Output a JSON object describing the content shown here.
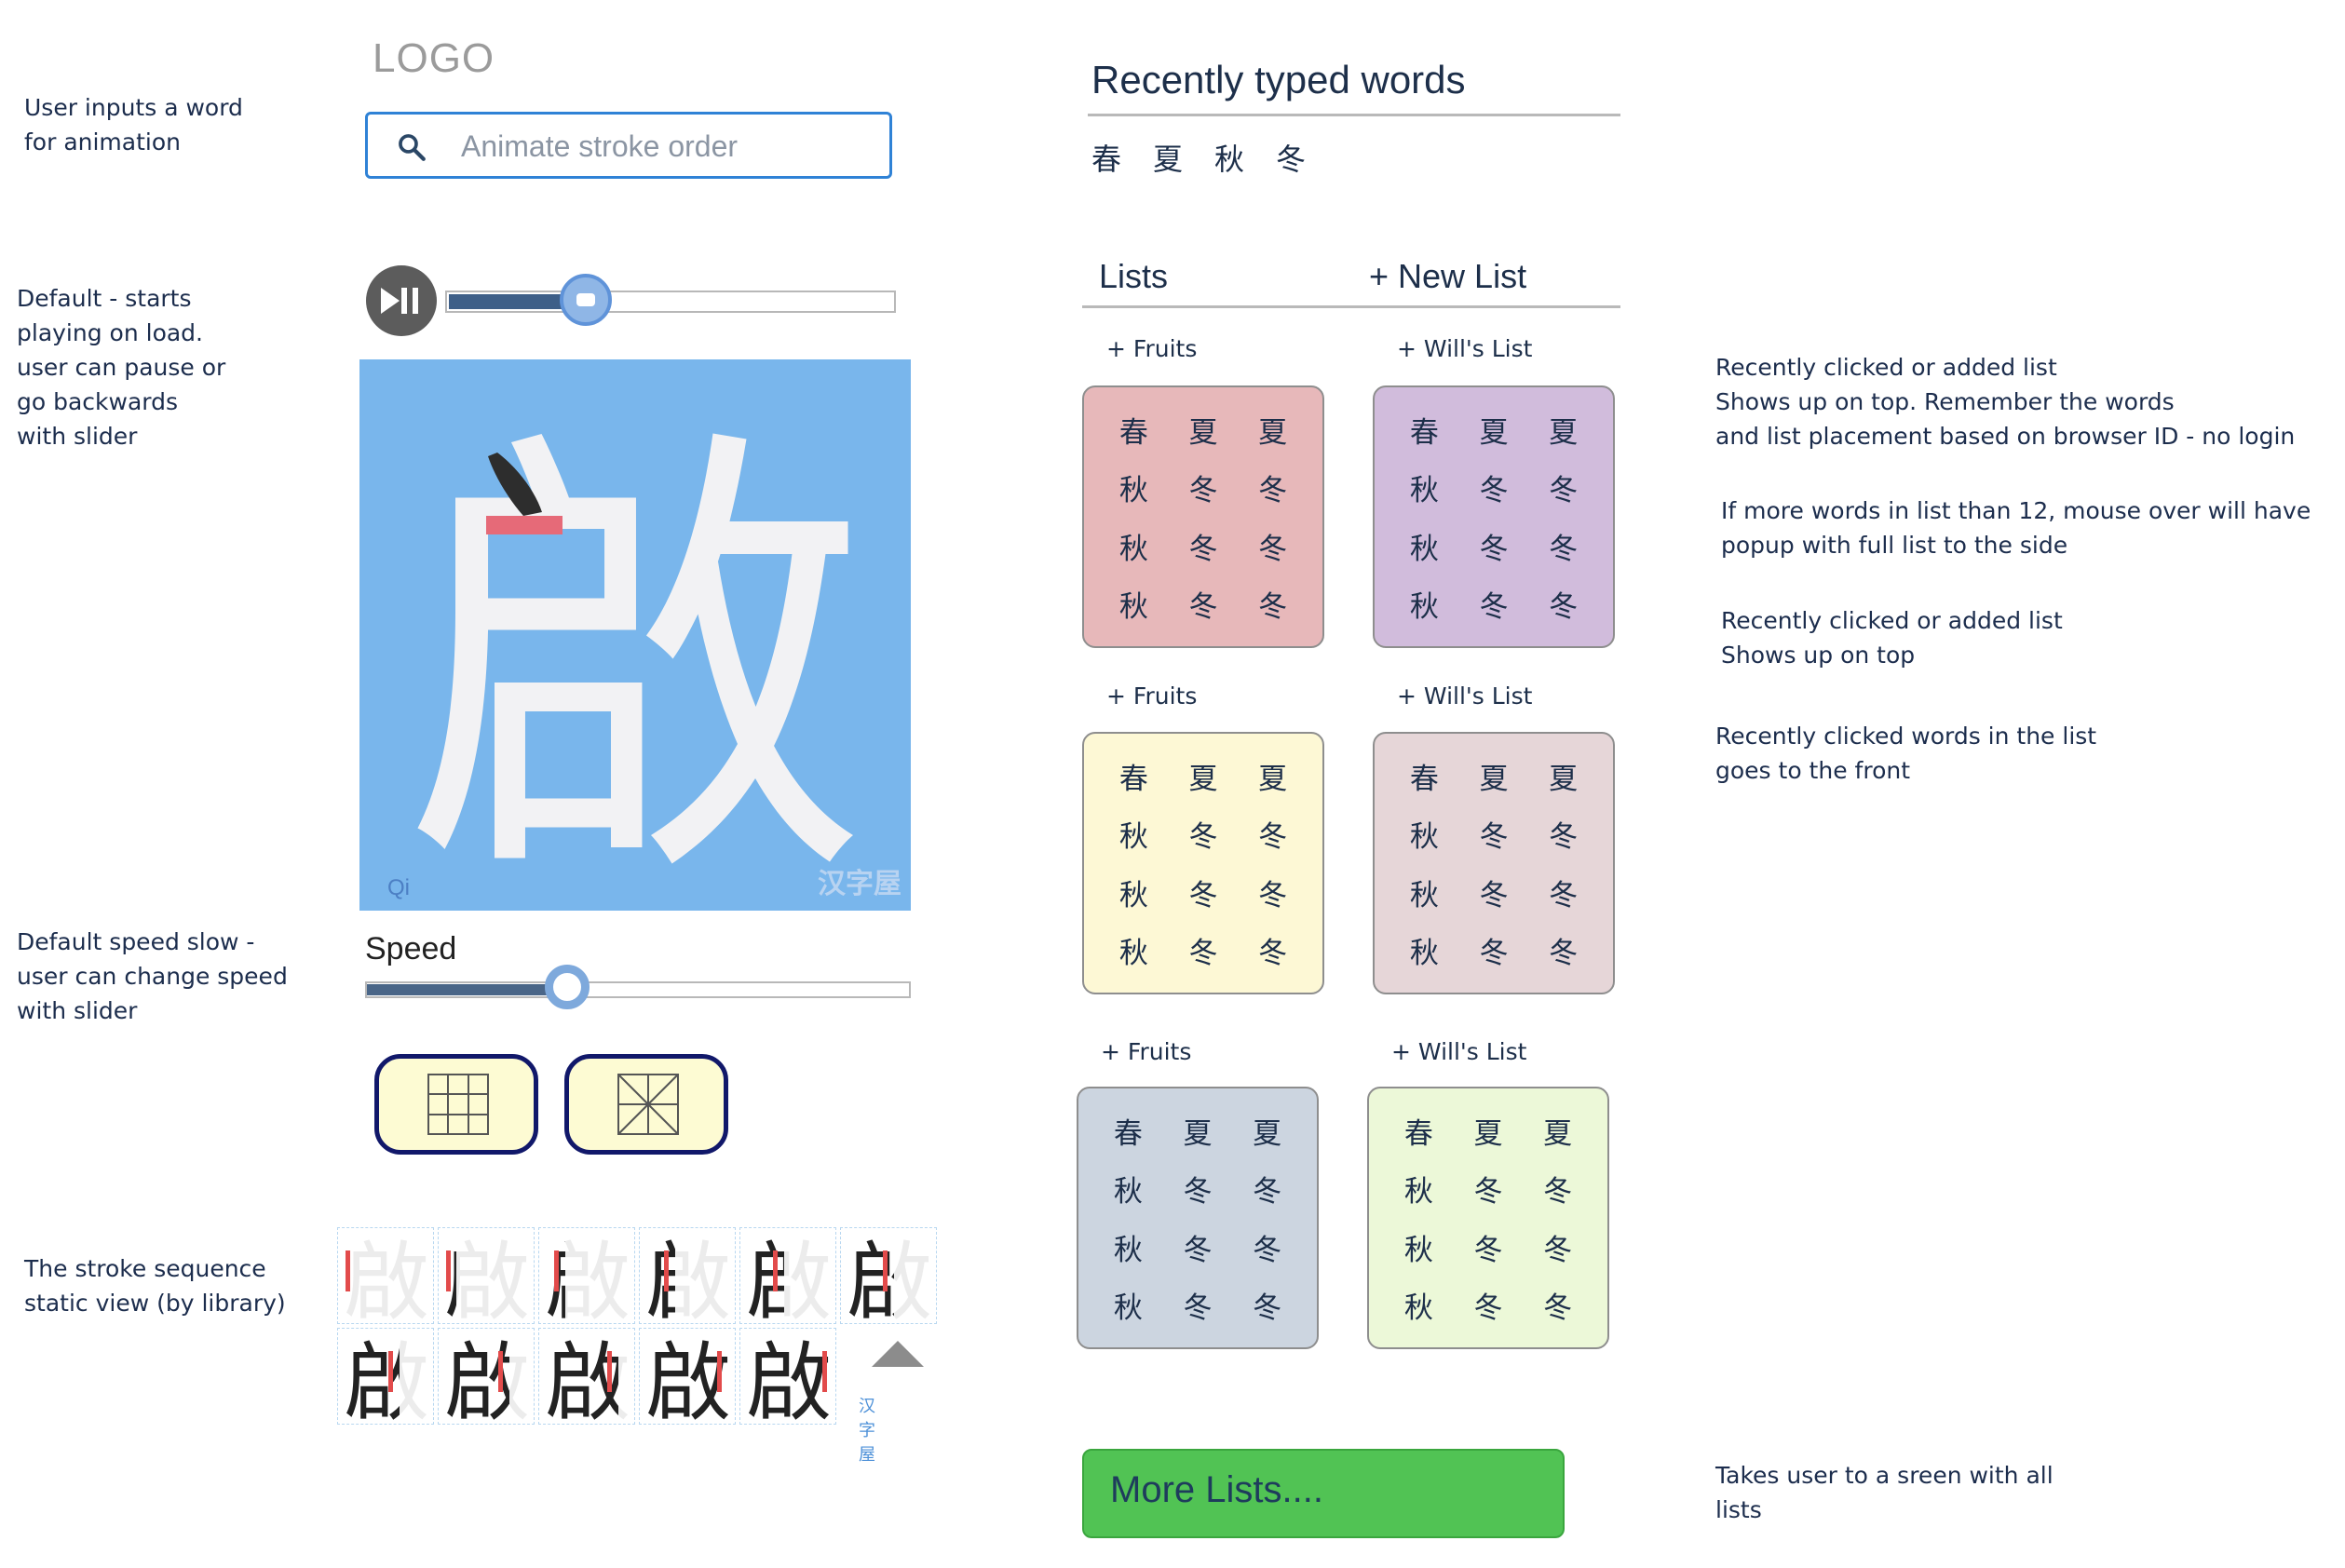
{
  "logo": "LOGO",
  "search": {
    "placeholder": "Animate stroke order"
  },
  "annotations": {
    "input": "User inputs a word\nfor animation",
    "default_play": "Default - starts\nplaying on load.\nuser can pause or\ngo backwards\nwith slider",
    "speed": "Default speed slow -\nuser can change speed\nwith slider",
    "stroke_seq": "The stroke sequence\nstatic view (by library)",
    "recent_list": "Recently clicked or added list\nShows up on top.  Remember the words\nand list placement based on browser ID - no login",
    "mouse_over": "If more words in list than 12, mouse over will have\npopup with full list to  the side",
    "recent_top": "Recently clicked or added list\nShows up on top",
    "recent_words": "Recently clicked words in the list\ngoes to the front",
    "more_lists": "Takes user to a sreen with all\nlists"
  },
  "playback": {
    "progress_pct": 31
  },
  "character": {
    "glyph": "啟",
    "pinyin": "Qi",
    "watermark": "汉字屋"
  },
  "speed": {
    "label": "Speed",
    "value_pct": 37
  },
  "grid_buttons": [
    {
      "icon": "grid-3x3-icon"
    },
    {
      "icon": "mi-grid-icon"
    }
  ],
  "stroke_sequence": {
    "glyph": "啟",
    "steps": 11,
    "watermark": "汉字屋"
  },
  "recent": {
    "title": "Recently typed words",
    "words": [
      "春",
      "夏",
      "秋",
      "冬"
    ]
  },
  "lists_header": {
    "lists": "Lists",
    "new_list": "+ New List"
  },
  "lists": [
    {
      "title": "+ Fruits",
      "color": "#e7b8ba",
      "words": [
        "春",
        "夏",
        "夏",
        "秋",
        "冬",
        "冬",
        "秋",
        "冬",
        "冬",
        "秋",
        "冬",
        "冬"
      ]
    },
    {
      "title": "+ Will's List",
      "color": "#d1bcdc",
      "words": [
        "春",
        "夏",
        "夏",
        "秋",
        "冬",
        "冬",
        "秋",
        "冬",
        "冬",
        "秋",
        "冬",
        "冬"
      ]
    },
    {
      "title": "+ Fruits",
      "color": "#fdf8d5",
      "words": [
        "春",
        "夏",
        "夏",
        "秋",
        "冬",
        "冬",
        "秋",
        "冬",
        "冬",
        "秋",
        "冬",
        "冬"
      ]
    },
    {
      "title": "+ Will's List",
      "color": "#e6d6d8",
      "words": [
        "春",
        "夏",
        "夏",
        "秋",
        "冬",
        "冬",
        "秋",
        "冬",
        "冬",
        "秋",
        "冬",
        "冬"
      ]
    },
    {
      "title": "+ Fruits",
      "color": "#ccd5e0",
      "words": [
        "春",
        "夏",
        "夏",
        "秋",
        "冬",
        "冬",
        "秋",
        "冬",
        "冬",
        "秋",
        "冬",
        "冬"
      ]
    },
    {
      "title": "+ Will's List",
      "color": "#ecf8d8",
      "words": [
        "春",
        "夏",
        "夏",
        "秋",
        "冬",
        "冬",
        "秋",
        "冬",
        "冬",
        "秋",
        "冬",
        "冬"
      ]
    }
  ],
  "more_button": {
    "label": "More Lists...."
  }
}
